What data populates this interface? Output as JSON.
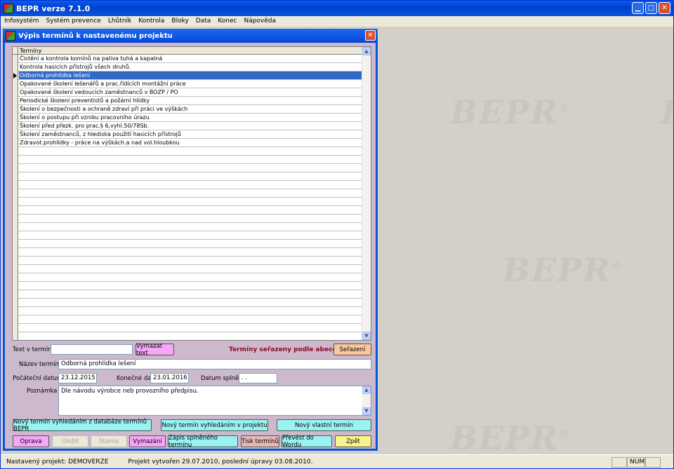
{
  "app": {
    "title": "BEPR verze 7.1.0"
  },
  "menu": [
    "Infosystém",
    "Systém prevence",
    "Lhůtník",
    "Kontrola",
    "Bloky",
    "Data",
    "Konec",
    "Nápověda"
  ],
  "window": {
    "title": "Výpis termínů k nastavenému projektu"
  },
  "grid": {
    "column": "Termíny",
    "rows": [
      "Čistění a kontrola komínů na paliva tuhá a kapalná",
      "Kontrola hasicích přístrojů všech druhů.",
      "Odborná prohlídka lešení",
      "Opakované školení lešenářů a prac.řídících montážní práce",
      "Opakované školení vedoucích zaměstnanců v BOZP / PO",
      "Periodické školení preventistů a požární hlídky",
      "Školení o bezpečnosti a ochraně zdraví při práci ve výškách",
      "Školení o postupu při vzniku pracovního úrazu",
      "Školení před přezk. pro prac.§ 6,vyhl.50/78Sb.",
      "Školení zaměstnanců, z hlediska použití hasicích přístrojů",
      "Zdravot.prohlídky - práce na výškách.a nad vol.hloubkou"
    ],
    "selected_index": 2
  },
  "form": {
    "search_label": "Text v termínu",
    "search_value": "",
    "clear_button": "Vymazat text",
    "sort_status": "Termíny seřazeny podle abecedy.",
    "sort_button": "Seřazení",
    "name_label": "Název termínu",
    "name_value": "Odborná prohlídka lešení",
    "start_label": "Počáteční datum",
    "start_value": "23.12.2015",
    "end_label": "Konečné datum",
    "end_value": "23.01.2016",
    "done_label": "Datum splnění",
    "done_value": " .  . ",
    "note_label": "Poznámka",
    "note_value": "Dle návodu výrobce neb provozního předpisu."
  },
  "buttons": {
    "new_from_db": "Nový termín vyhledáním z databáze termínů BEPR",
    "new_from_project": "Nový termín vyhledáním v projektu",
    "new_own": "Nový vlastní termín",
    "edit": "Oprava",
    "save": "Uložit",
    "cancel": "Storno",
    "delete": "Vymazání",
    "record_done": "Zápis splněného termínu",
    "print": "Tisk termínů",
    "to_word": "Převést do Wordu",
    "back": "Zpět"
  },
  "status": {
    "project": "Nastavený projekt: DEMOVERZE",
    "created": "Projekt vytvořen 29.07.2010, poslední úpravy 03.08.2010.",
    "num": "NUM"
  },
  "watermark": "BEPR",
  "colors": {
    "form_bg": "#ccbacc",
    "pink_button": "#f6a6f6",
    "cyan_button": "#99f2f2",
    "orange_button": "#f8c79a",
    "yellow_button": "#f7f48e",
    "selection": "#316ac5",
    "status_text": "#8b0a28"
  }
}
